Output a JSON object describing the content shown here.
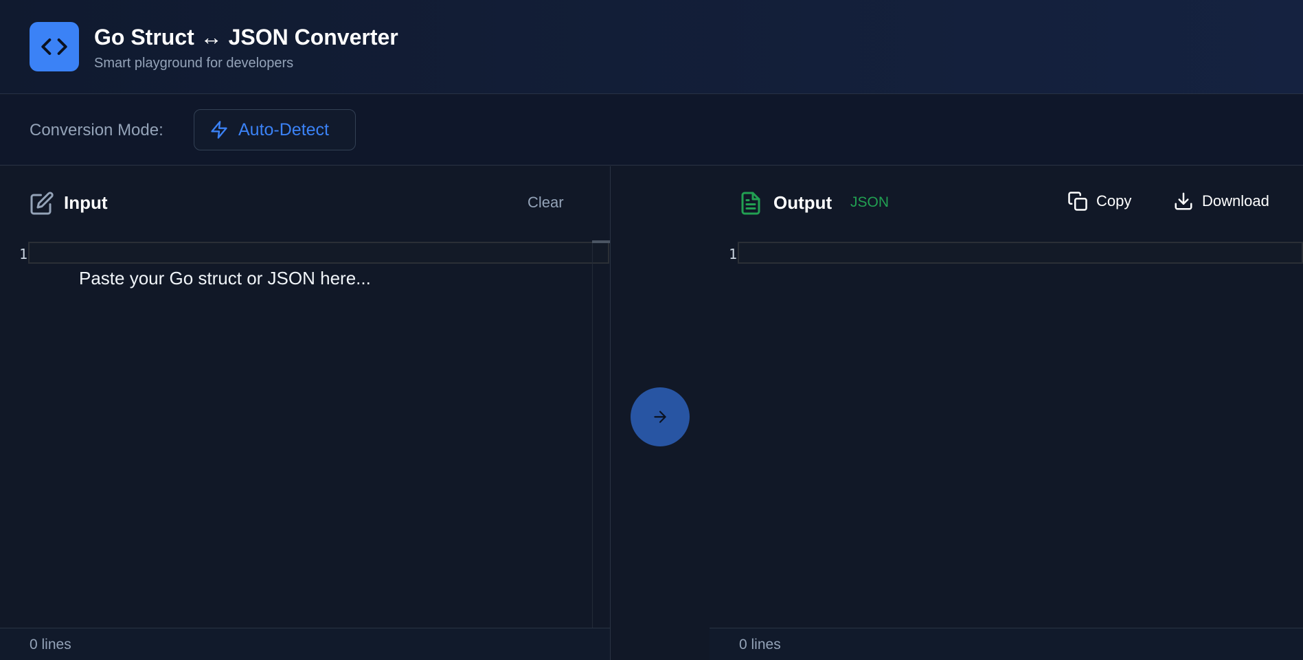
{
  "header": {
    "title": "Go Struct ↔ JSON Converter",
    "subtitle": "Smart playground for developers",
    "logo_icon": "code-brackets-icon"
  },
  "mode": {
    "label": "Conversion Mode:",
    "button_label": "Auto-Detect",
    "button_icon": "lightning-icon"
  },
  "input_panel": {
    "title": "Input",
    "icon": "edit-icon",
    "clear_label": "Clear",
    "line_number": "1",
    "placeholder": "Paste your Go struct or JSON here...",
    "lines_status": "0 lines"
  },
  "output_panel": {
    "title": "Output",
    "icon": "document-icon",
    "format_badge": "JSON",
    "copy_label": "Copy",
    "download_label": "Download",
    "line_number": "1",
    "lines_status": "0 lines"
  },
  "convert": {
    "icon": "arrow-right-icon"
  },
  "colors": {
    "accent": "#3b82f6",
    "success": "#22a052",
    "background": "#111827",
    "header_bg": "#152240"
  }
}
